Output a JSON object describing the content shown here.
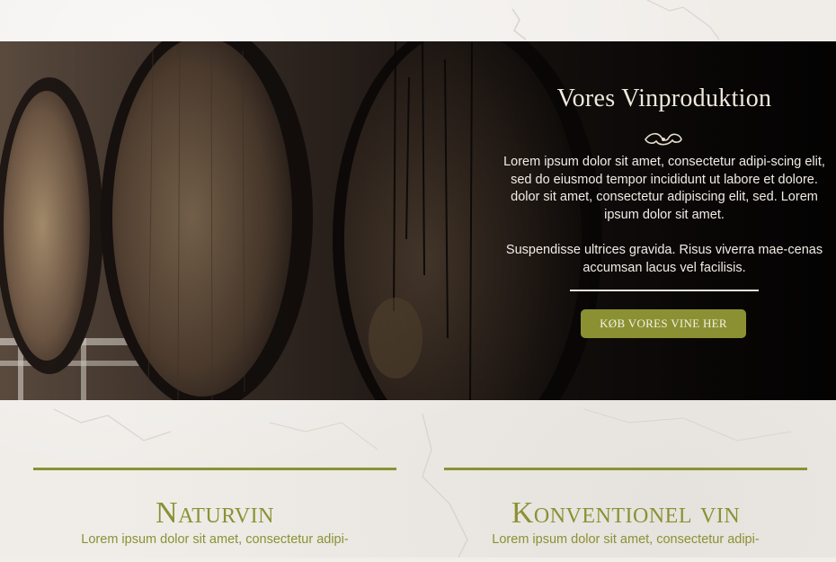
{
  "hero": {
    "title": "Vores Vinproduktion",
    "ornament_icon": "flourish-ornament-icon",
    "paragraph1": "Lorem ipsum dolor sit amet, consectetur adipi-scing elit, sed do eiusmod tempor incididunt ut labore et dolore. dolor sit amet, consectetur adipiscing elit, sed. Lorem ipsum dolor sit amet.",
    "paragraph2": "Suspendisse ultrices gravida. Risus viverra mae-cenas accumsan lacus vel facilisis.",
    "cta_label": "KØB VORES VINE HER"
  },
  "columns": [
    {
      "title": "Naturvin",
      "text": "Lorem ipsum dolor sit amet, consectetur adipi-"
    },
    {
      "title": "Konventionel vin",
      "text": "Lorem ipsum dolor sit amet, consectetur adipi-"
    }
  ],
  "colors": {
    "accent": "#8b9133",
    "hero_background": "#1a1412",
    "page_background": "#f1eeea"
  }
}
